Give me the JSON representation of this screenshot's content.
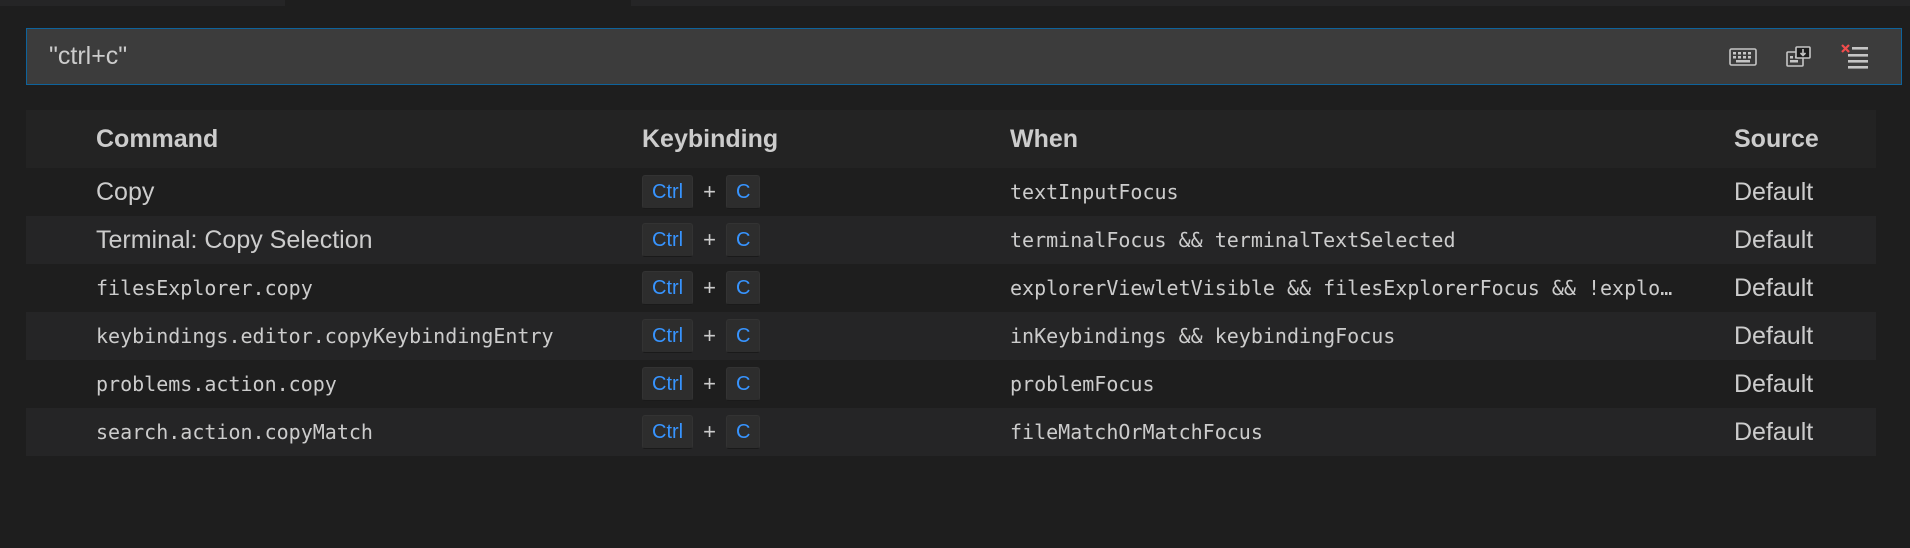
{
  "search": {
    "value": "\"ctrl+c\"",
    "actions": [
      {
        "name": "record-keys-icon"
      },
      {
        "name": "sort-by-precedence-icon"
      },
      {
        "name": "clear-search-icon"
      }
    ]
  },
  "table": {
    "headers": {
      "command": "Command",
      "keybinding": "Keybinding",
      "when": "When",
      "source": "Source"
    },
    "rows": [
      {
        "command": "Copy",
        "command_style": "label",
        "keys": [
          "Ctrl",
          "C"
        ],
        "when": "textInputFocus",
        "source": "Default"
      },
      {
        "command": "Terminal: Copy Selection",
        "command_style": "label",
        "keys": [
          "Ctrl",
          "C"
        ],
        "when": "terminalFocus && terminalTextSelected",
        "source": "Default"
      },
      {
        "command": "filesExplorer.copy",
        "command_style": "id",
        "keys": [
          "Ctrl",
          "C"
        ],
        "when": "explorerViewletVisible && filesExplorerFocus && !explo…",
        "source": "Default"
      },
      {
        "command": "keybindings.editor.copyKeybindingEntry",
        "command_style": "id",
        "keys": [
          "Ctrl",
          "C"
        ],
        "when": "inKeybindings && keybindingFocus",
        "source": "Default"
      },
      {
        "command": "problems.action.copy",
        "command_style": "id",
        "keys": [
          "Ctrl",
          "C"
        ],
        "when": "problemFocus",
        "source": "Default"
      },
      {
        "command": "search.action.copyMatch",
        "command_style": "id",
        "keys": [
          "Ctrl",
          "C"
        ],
        "when": "fileMatchOrMatchFocus",
        "source": "Default"
      }
    ],
    "plus": "+"
  },
  "colors": {
    "background": "#1e1e1e",
    "input_border": "#0e639c",
    "key_text": "#3794ff"
  }
}
